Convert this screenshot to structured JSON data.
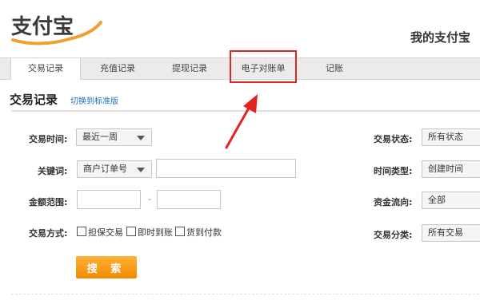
{
  "header": {
    "logo_text": "支付宝",
    "my_account_title": "我的支付宝"
  },
  "tabs": [
    {
      "label": "交易记录",
      "active": true
    },
    {
      "label": "充值记录",
      "active": false
    },
    {
      "label": "提现记录",
      "active": false
    },
    {
      "label": "电子对账单",
      "active": false,
      "highlighted": true
    },
    {
      "label": "记账",
      "active": false
    }
  ],
  "section": {
    "title": "交易记录",
    "switch_link": "切换到标准版"
  },
  "form": {
    "trade_time": {
      "label": "交易时间:",
      "value": "最近一周"
    },
    "keyword": {
      "label": "关键词:",
      "select_value": "商户订单号",
      "input_value": ""
    },
    "amount_range": {
      "label": "金额范围:",
      "from": "",
      "to": "",
      "separator": "-"
    },
    "trade_method": {
      "label": "交易方式:",
      "options": [
        {
          "label": "担保交易",
          "checked": false
        },
        {
          "label": "即时到账",
          "checked": false
        },
        {
          "label": "货到付款",
          "checked": false
        }
      ]
    },
    "trade_status": {
      "label": "交易状态:",
      "value": "所有状态"
    },
    "time_type": {
      "label": "时间类型:",
      "value": "创建时间"
    },
    "fund_flow": {
      "label": "资金流向:",
      "value": "全部"
    },
    "trade_category": {
      "label": "交易分类:",
      "value": "所有交易"
    },
    "search_button": "搜 索"
  },
  "colors": {
    "accent_orange": "#f08a00",
    "highlight_red": "#e32222",
    "link_blue": "#1a6fba"
  }
}
